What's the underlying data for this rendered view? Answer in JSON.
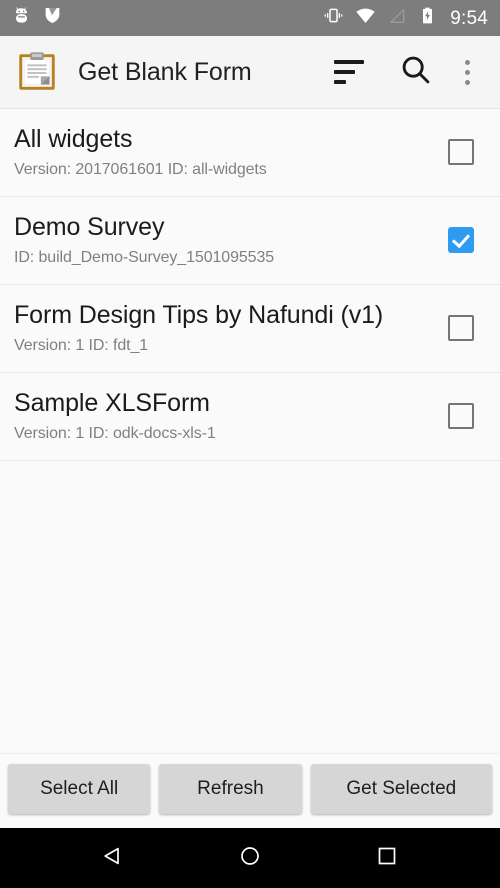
{
  "status_bar": {
    "left_icons": [
      "android-bug-icon",
      "odk-check-icon"
    ],
    "right_icons": [
      "vibrate-icon",
      "wifi-icon",
      "cell-signal-icon",
      "battery-charging-icon"
    ],
    "clock": "9:54",
    "background_color": "#7D7D7D"
  },
  "app_bar": {
    "logo_icon": "clipboard-icon",
    "title": "Get Blank Form",
    "actions": [
      {
        "name": "sort-icon",
        "label": "Sort"
      },
      {
        "name": "search-icon",
        "label": "Search"
      },
      {
        "name": "overflow-menu-icon",
        "label": "More options"
      }
    ],
    "background_color": "#F5F5F5"
  },
  "forms": [
    {
      "title": "All widgets",
      "subtitle": "Version: 2017061601 ID: all-widgets",
      "checked": false
    },
    {
      "title": "Demo Survey",
      "subtitle": "ID: build_Demo-Survey_1501095535",
      "checked": true
    },
    {
      "title": "Form Design Tips by Nafundi (v1)",
      "subtitle": "Version: 1 ID: fdt_1",
      "checked": false
    },
    {
      "title": "Sample XLSForm",
      "subtitle": "Version: 1 ID: odk-docs-xls-1",
      "checked": false
    }
  ],
  "buttons": {
    "select_all": "Select All",
    "refresh": "Refresh",
    "get_selected": "Get Selected"
  },
  "nav_bar": {
    "back": "back-icon",
    "home": "home-icon",
    "recents": "recents-icon",
    "background_color": "#000000"
  },
  "colors": {
    "accent": "#2D9CF0",
    "background": "#FAFAFA",
    "checkbox_unchecked": "#757575",
    "title_text": "#1B1B1B",
    "subtitle_text": "#808080"
  }
}
